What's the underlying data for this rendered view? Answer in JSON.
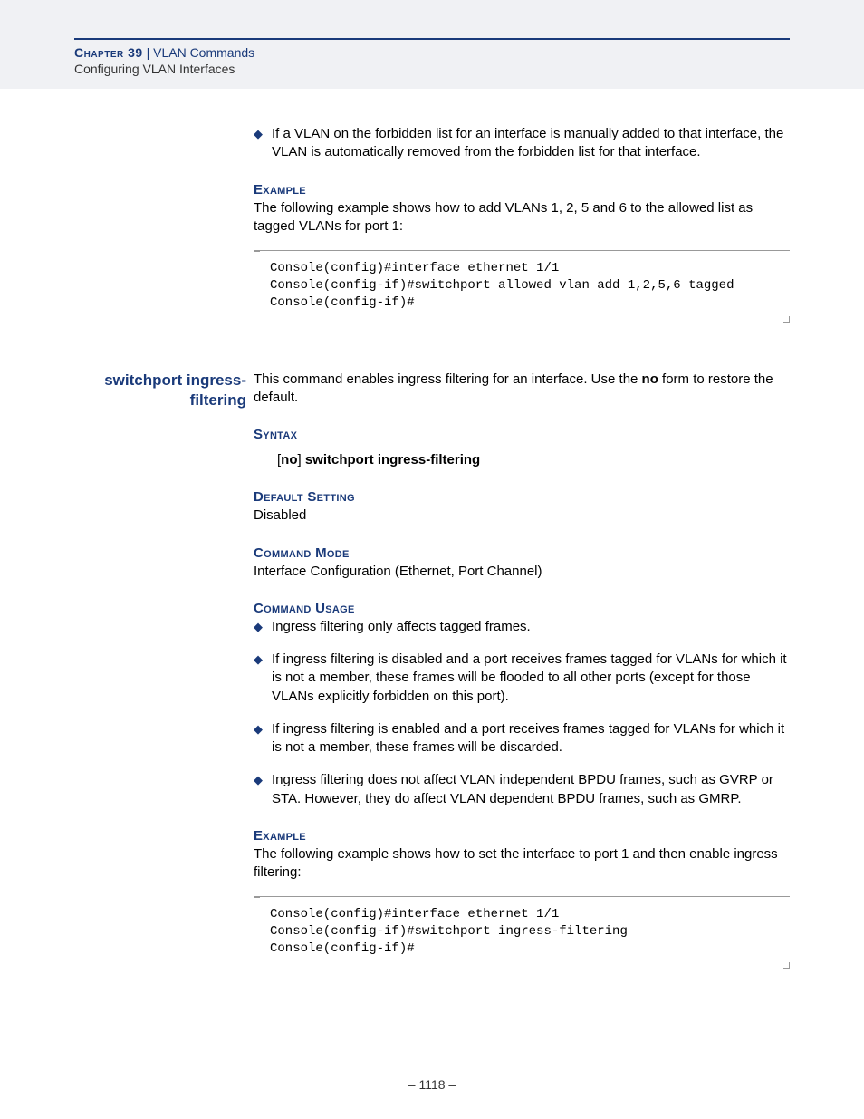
{
  "header": {
    "chapter_label": "Chapter 39",
    "separator": "  |  ",
    "chapter_title": "VLAN Commands",
    "subtitle": "Configuring VLAN Interfaces"
  },
  "top_bullet": "If a VLAN on the forbidden list for an interface is manually added to that interface, the VLAN is automatically removed from the forbidden list for that interface.",
  "example1": {
    "label": "Example",
    "text": "The following example shows how to add VLANs 1, 2, 5 and 6 to the allowed list as tagged VLANs for port 1:",
    "code": "Console(config)#interface ethernet 1/1\nConsole(config-if)#switchport allowed vlan add 1,2,5,6 tagged\nConsole(config-if)#"
  },
  "cmd": {
    "name": "switchport ingress-filtering",
    "desc_pre": "This command enables ingress filtering for an interface. Use the ",
    "desc_bold": "no",
    "desc_post": " form to restore the default.",
    "syntax_label": "Syntax",
    "syntax_br_open": "[",
    "syntax_no": "no",
    "syntax_br_close": "] ",
    "syntax_cmd": "switchport ingress-filtering",
    "default_label": "Default Setting",
    "default_value": "Disabled",
    "mode_label": "Command Mode",
    "mode_value": "Interface Configuration (Ethernet, Port Channel)",
    "usage_label": "Command Usage",
    "usage_bullets": [
      "Ingress filtering only affects tagged frames.",
      "If ingress filtering is disabled and a port receives frames tagged for VLANs for which it is not a member, these frames will be flooded to all other ports (except for those VLANs explicitly forbidden on this port).",
      "If ingress filtering is enabled and a port receives frames tagged for VLANs for which it is not a member, these frames will be discarded.",
      "Ingress filtering does not affect VLAN independent BPDU frames, such as GVRP or STA. However, they do affect VLAN dependent BPDU frames, such as GMRP."
    ],
    "example_label": "Example",
    "example_text": "The following example shows how to set the interface to port 1 and then enable ingress filtering:",
    "example_code": "Console(config)#interface ethernet 1/1\nConsole(config-if)#switchport ingress-filtering\nConsole(config-if)#"
  },
  "page_number": "–  1118  –"
}
